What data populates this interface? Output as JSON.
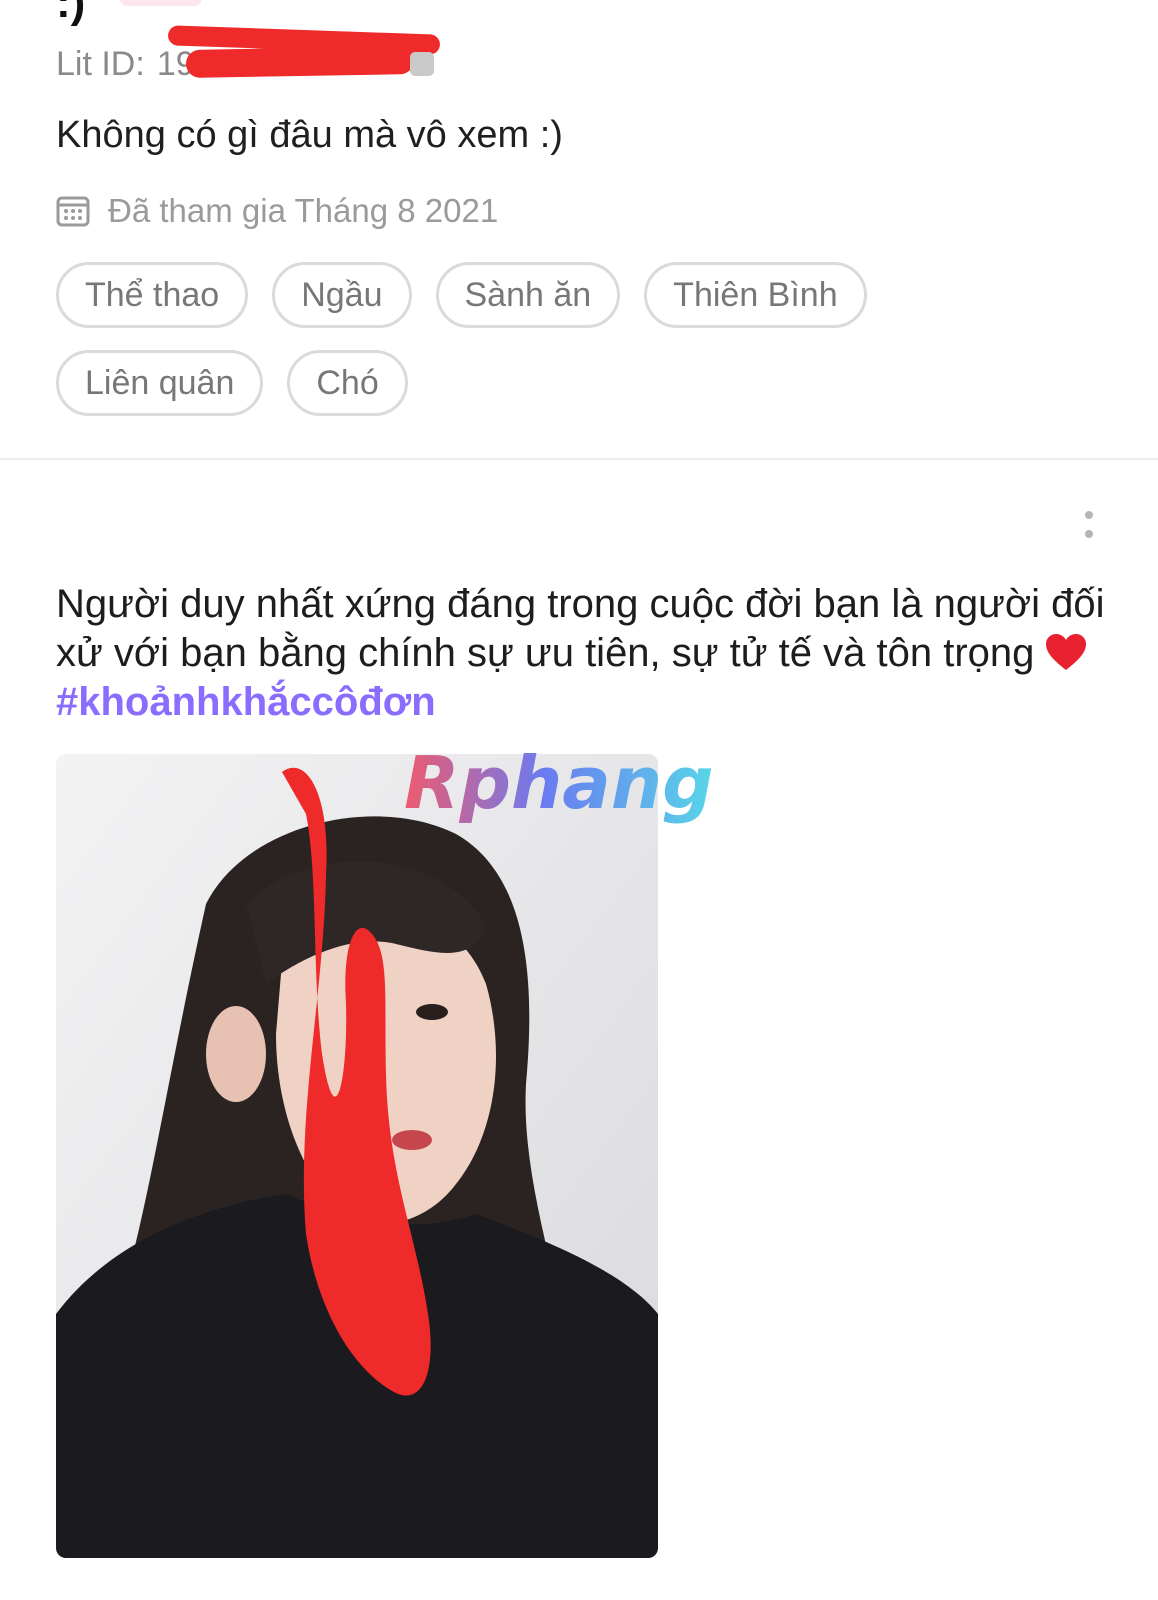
{
  "header": {
    "name_fragment": ":)",
    "lit_id_label": "Lit ID:",
    "lit_id_partial": "19",
    "bio": "Không có gì đâu mà vô xem  :)",
    "joined_text": "Đã tham gia Tháng 8 2021"
  },
  "tags": [
    [
      "Thể thao",
      "Ngầu",
      "Sành ăn",
      "Thiên Bình"
    ],
    [
      "Liên quân",
      "Chó"
    ]
  ],
  "post": {
    "text": "Người duy nhất xứng đáng trong cuộc đời bạn là người đối xử với bạn bằng chính sự ưu tiên, sự tử tế và tôn trọng",
    "hashtag": "#khoảnhkhắccôđơn"
  },
  "watermark": {
    "text": "Rphang"
  },
  "icons": {
    "calendar": "calendar-icon",
    "copy": "copy-icon",
    "more": "more-vertical-icon",
    "heart": "heart-icon"
  },
  "colors": {
    "hashtag": "#8a6cff",
    "redaction": "#ef2a2a",
    "muted_text": "#9a9a9a",
    "tag_border": "#d9d9de"
  }
}
